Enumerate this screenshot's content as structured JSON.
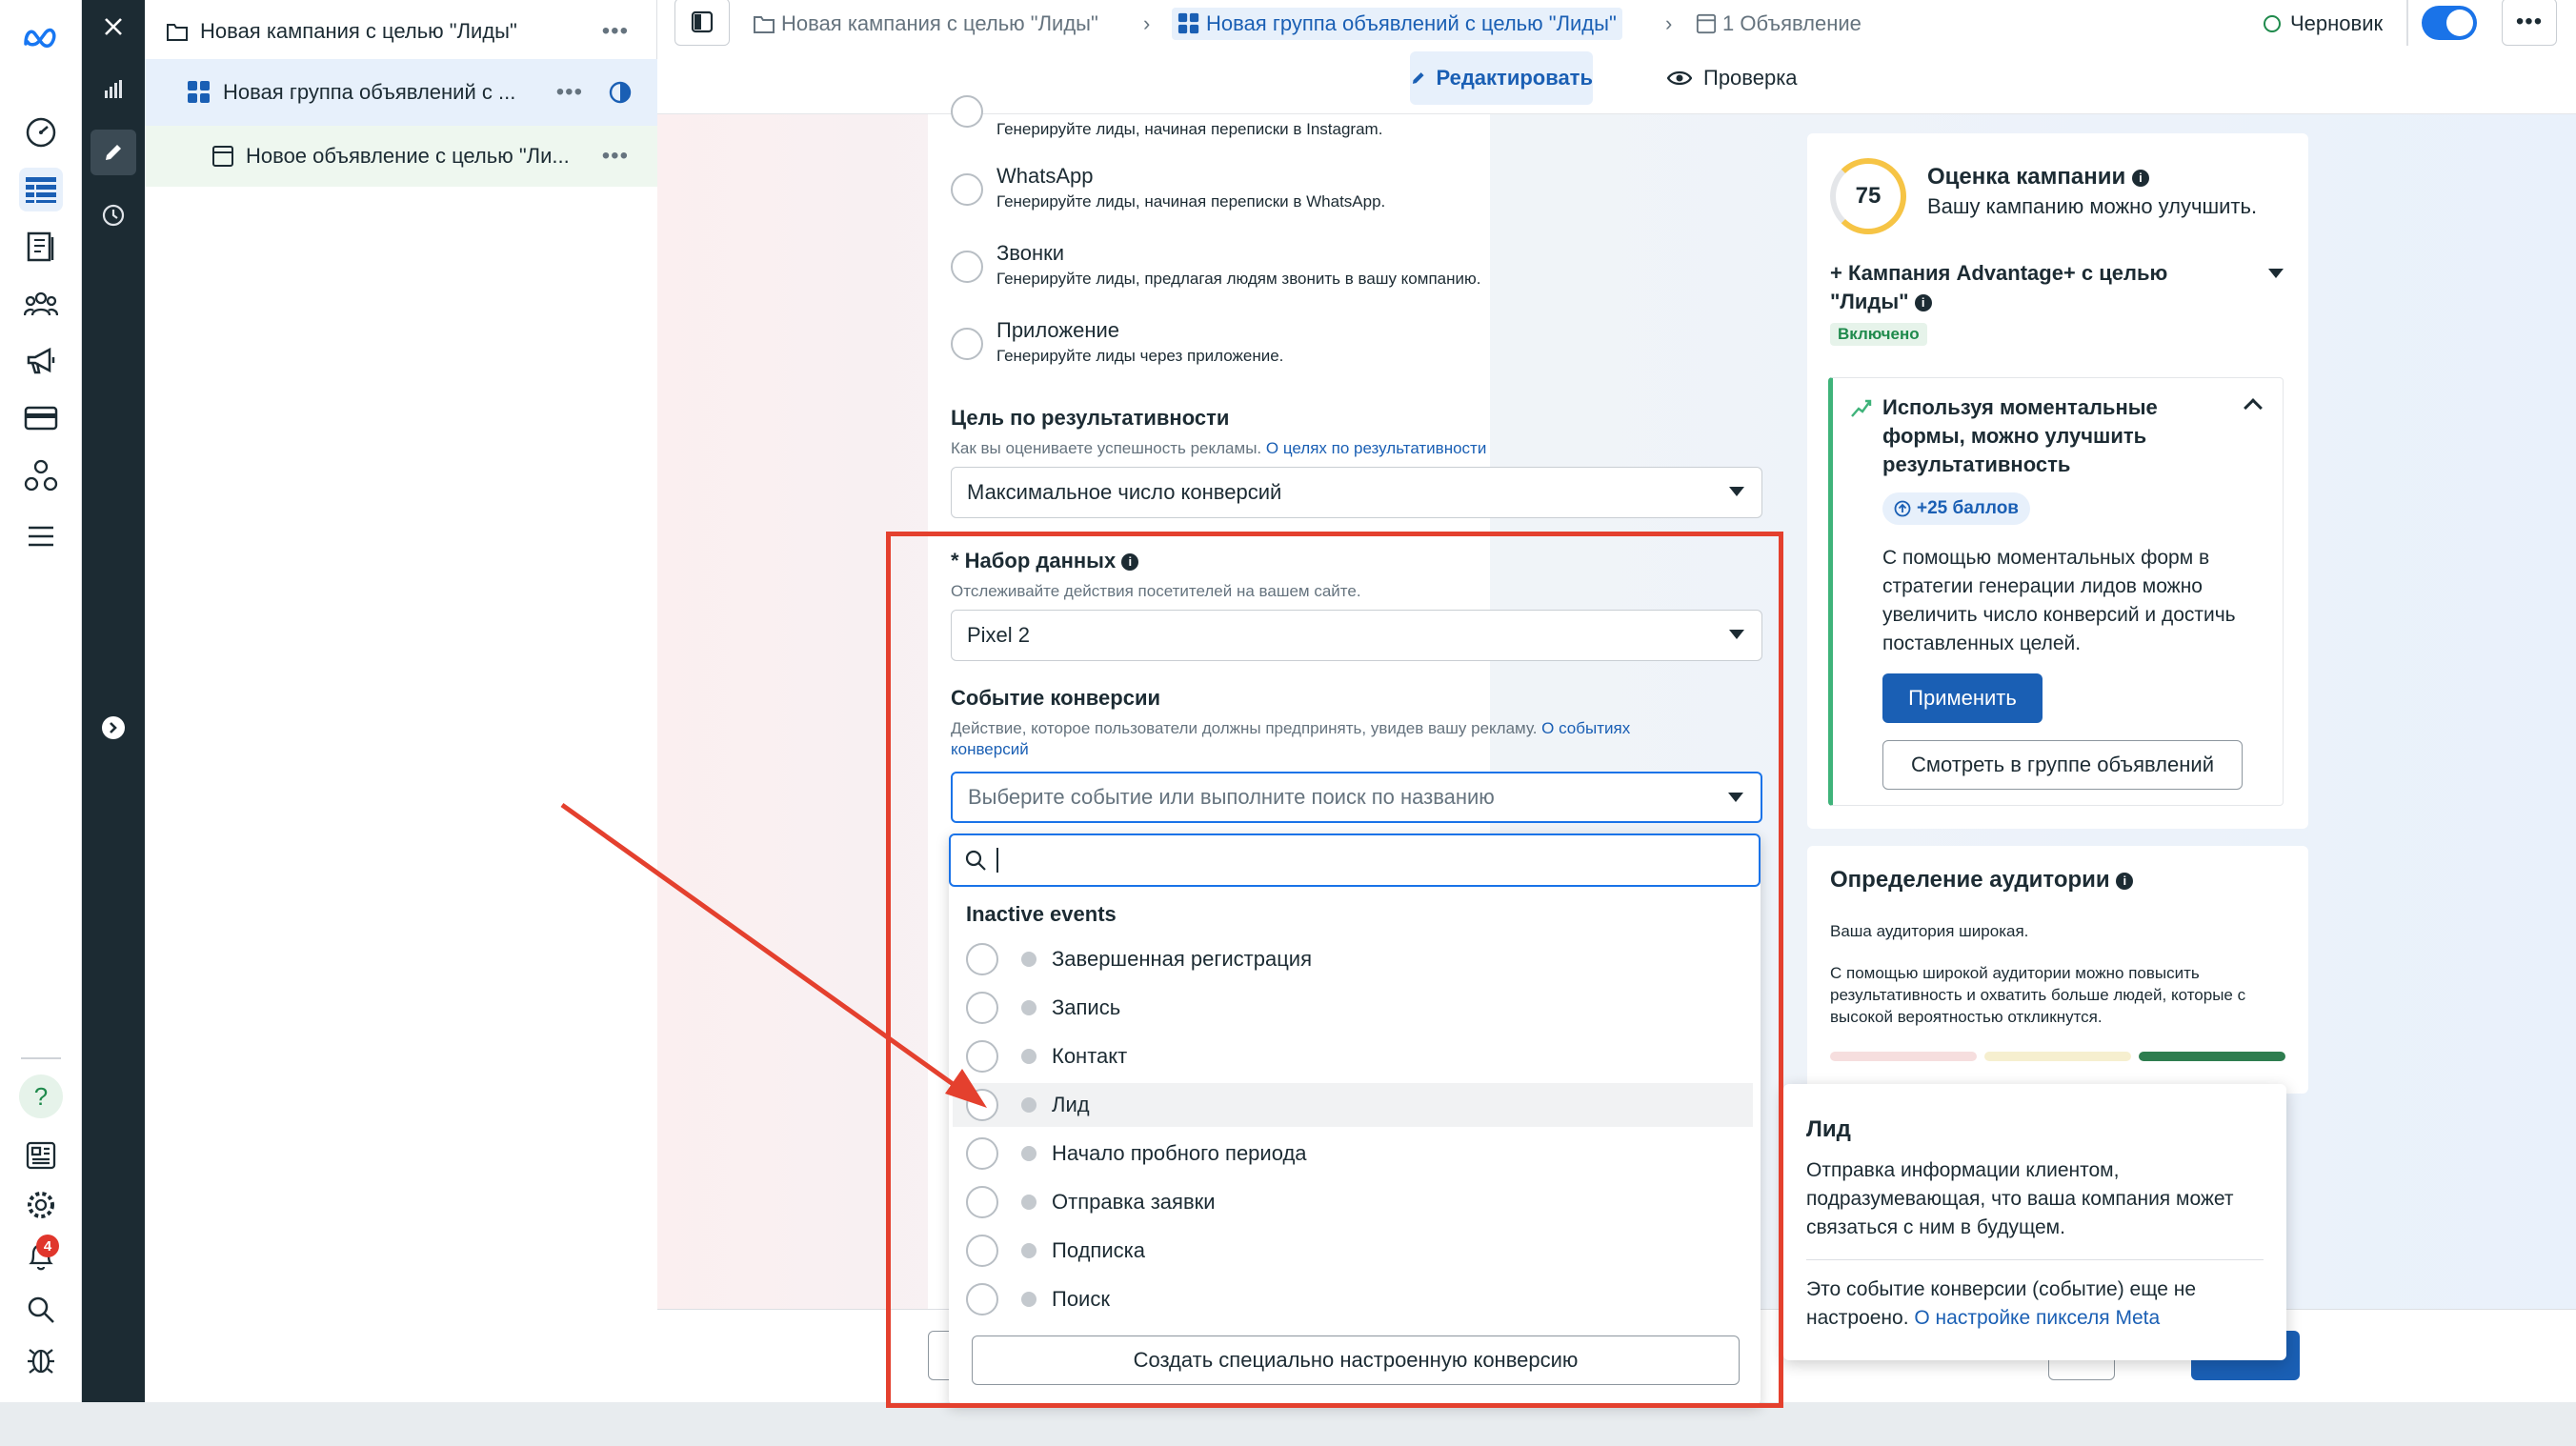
{
  "breadcrumbs": {
    "campaign": "Новая кампания с целью \"Лиды\"",
    "adset": "Новая группа объявлений с целью \"Лиды\"",
    "ads": "1 Объявление"
  },
  "status": {
    "label": "Черновик"
  },
  "tabs": {
    "edit": "Редактировать",
    "review": "Проверка"
  },
  "tree": {
    "campaign": "Новая кампания с целью \"Лиды\"",
    "adset": "Новая группа объявлений с ...",
    "ad": "Новое объявление с целью \"Ли...",
    "more": "•••"
  },
  "rail": {
    "notifications_count": "4"
  },
  "form": {
    "instagram_desc": "Генерируйте лиды, начиная переписки в Instagram.",
    "options": [
      {
        "title": "WhatsApp",
        "desc": "Генерируйте лиды, начиная переписки в WhatsApp."
      },
      {
        "title": "Звонки",
        "desc": "Генерируйте лиды, предлагая людям звонить в вашу компанию."
      },
      {
        "title": "Приложение",
        "desc": "Генерируйте лиды через приложение."
      }
    ],
    "perf_goal": {
      "label": "Цель по результативности",
      "hint": "Как вы оцениваете успешность рекламы.",
      "link": "О целях по результативности",
      "value": "Максимальное число конверсий"
    },
    "dataset": {
      "label": "* Набор данных",
      "hint": "Отслеживайте действия посетителей на вашем сайте.",
      "value": "Pixel 2"
    },
    "conversion_event": {
      "label": "Событие конверсии",
      "hint": "Действие, которое пользователи должны предпринять, увидев вашу рекламу.",
      "link_part1": "О событиях",
      "link_part2": "конверсий",
      "placeholder": "Выберите событие или выполните поиск по названию"
    }
  },
  "dropdown": {
    "group_title": "Inactive events",
    "events": [
      "Завершенная регистрация",
      "Запись",
      "Контакт",
      "Лид",
      "Начало пробного периода",
      "Отправка заявки",
      "Подписка",
      "Поиск"
    ],
    "hovered_index": 3,
    "create_button": "Создать специально настроенную конверсию"
  },
  "campaign_score": {
    "score": "75",
    "title": "Оценка кампании",
    "subtitle": "Вашу кампанию можно улучшить.",
    "advantage_title_1": "Кампания Advantage+ с целью",
    "advantage_title_2": "\"Лиды\"",
    "advantage_status": "Включено",
    "rec_title": "Используя моментальные формы, можно улучшить результативность",
    "rec_points": "+25 баллов",
    "rec_body": "С помощью моментальных форм в стратегии генерации лидов можно увеличить число конверсий и достичь поставленных целей.",
    "apply_button": "Применить",
    "view_button": "Смотреть в группе объявлений"
  },
  "audience": {
    "title": "Определение аудитории",
    "subtitle": "Ваша аудитория широкая.",
    "body": "С помощью широкой аудитории можно повысить результативность и охватить больше людей, которые с высокой вероятностью откликнутся."
  },
  "tooltip": {
    "title": "Лид",
    "body": "Отправка информации клиентом, подразумевающая, что ваша компания может связаться с ним в будущем.",
    "note": "Это событие конверсии (событие) еще не настроено.",
    "link": "О настройке пикселя Meta"
  },
  "colors": {
    "accent": "#1a5fb4",
    "annotation": "#e4402e",
    "dark_strip": "#1c2b33",
    "success": "#1f8a4c"
  }
}
